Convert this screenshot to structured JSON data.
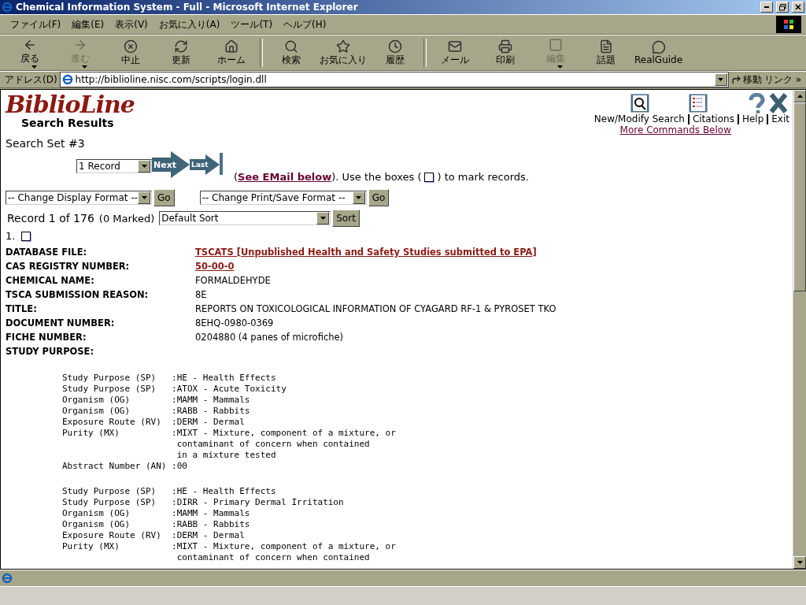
{
  "window": {
    "title": "Chemical Information System - Full - Microsoft Internet Explorer"
  },
  "menu": [
    "ファイル(F)",
    "編集(E)",
    "表示(V)",
    "お気に入り(A)",
    "ツール(T)",
    "ヘルプ(H)"
  ],
  "toolbar": {
    "groups": [
      [
        {
          "label": "戻る",
          "disabled": false,
          "has_menu": true
        },
        {
          "label": "進む",
          "disabled": true,
          "has_menu": true
        },
        {
          "label": "中止",
          "disabled": false,
          "has_menu": false
        },
        {
          "label": "更新",
          "disabled": false,
          "has_menu": false
        },
        {
          "label": "ホーム",
          "disabled": false,
          "has_menu": false
        }
      ],
      [
        {
          "label": "検索",
          "disabled": false,
          "has_menu": false
        },
        {
          "label": "お気に入り",
          "disabled": false,
          "has_menu": false
        },
        {
          "label": "履歴",
          "disabled": false,
          "has_menu": false
        }
      ],
      [
        {
          "label": "メール",
          "disabled": false,
          "has_menu": false
        },
        {
          "label": "印刷",
          "disabled": false,
          "has_menu": false
        },
        {
          "label": "編集",
          "disabled": true,
          "has_menu": true
        },
        {
          "label": "話題",
          "disabled": false,
          "has_menu": false
        },
        {
          "label": "RealGuide",
          "disabled": false,
          "has_menu": false
        }
      ]
    ]
  },
  "address_bar": {
    "label": "アドレス(D)",
    "value": "http://biblioline.nisc.com/scripts/login.dll",
    "go": "移動",
    "links": "リンク »"
  },
  "page": {
    "logo": "BiblioLine",
    "subtitle": "Search Results",
    "commands": [
      "New/Modify Search",
      "Citations",
      "Help",
      "Exit"
    ],
    "more_commands": "More Commands Below",
    "search_set": "Search Set #3",
    "record_select": "1 Record",
    "next": "Next",
    "last": "Last",
    "instructions": {
      "open": "(",
      "link": "See EMail below",
      "middle": "). Use the boxes (",
      "end": ") to mark records."
    },
    "display_format": {
      "value": "-- Change Display Format --",
      "button": "Go"
    },
    "print_format": {
      "value": "-- Change Print/Save Format --",
      "button": "Go"
    },
    "record_count": "Record 1 of 176",
    "marked": "(0 Marked)",
    "sort": {
      "value": "Default Sort",
      "button": "Sort"
    },
    "records": [
      {
        "number": "1.",
        "checked": false,
        "fields": [
          {
            "label": "DATABASE FILE:",
            "value": "TSCATS [Unpublished Health and Safety Studies submitted to EPA]",
            "kind": "link"
          },
          {
            "label": "CAS REGISTRY NUMBER:",
            "value": "50-00-0",
            "kind": "link"
          },
          {
            "label": "CHEMICAL NAME:",
            "value": "FORMALDEHYDE",
            "kind": "text"
          },
          {
            "label": "TSCA SUBMISSION REASON:",
            "value": "8E",
            "kind": "text"
          },
          {
            "label": "TITLE:",
            "value": "REPORTS ON TOXICOLOGICAL INFORMATION OF CYAGARD RF-1 & PYROSET TKO",
            "kind": "text"
          },
          {
            "label": "DOCUMENT NUMBER:",
            "value": "8EHQ-0980-0369",
            "kind": "text"
          },
          {
            "label": "FICHE NUMBER:",
            "value": "0204880 (4 panes of microfiche)",
            "kind": "text"
          },
          {
            "label": "STUDY PURPOSE:"
          }
        ],
        "study_groups": [
          [
            "Study Purpose (SP)   :HE - Health Effects",
            "Study Purpose (SP)   :ATOX - Acute Toxicity",
            "Organism (OG)        :MAMM - Mammals",
            "Organism (OG)        :RABB - Rabbits",
            "Exposure Route (RV)  :DERM - Dermal",
            "Purity (MX)          :MIXT - Mixture, component of a mixture, or",
            "                      contaminant of concern when contained",
            "                      in a mixture tested",
            "Abstract Number (AN) :00"
          ],
          [
            "Study Purpose (SP)   :HE - Health Effects",
            "Study Purpose (SP)   :DIRR - Primary Dermal Irritation",
            "Organism (OG)        :MAMM - Mammals",
            "Organism (OG)        :RABB - Rabbits",
            "Exposure Route (RV)  :DERM - Dermal",
            "Purity (MX)          :MIXT - Mixture, component of a mixture, or",
            "                      contaminant of concern when contained"
          ]
        ]
      }
    ]
  }
}
